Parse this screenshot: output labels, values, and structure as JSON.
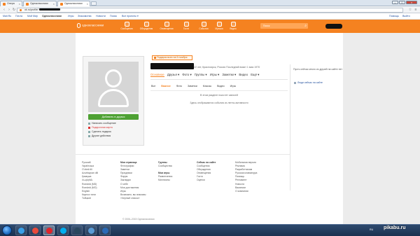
{
  "browser": {
    "tabs": [
      {
        "label": "Опера"
      },
      {
        "label": "Одноклассники"
      },
      {
        "label": "Одноклассники"
      }
    ],
    "url_prefix": "ok.ru/profile/",
    "bookmarks": [
      {
        "label": "Mail.Ru"
      },
      {
        "label": "Почта"
      },
      {
        "label": "Мой Мир"
      },
      {
        "label": "Одноклассники"
      },
      {
        "label": "Игры"
      },
      {
        "label": "Знакомства"
      },
      {
        "label": "Новости"
      },
      {
        "label": "Поиск"
      },
      {
        "label": "Все проекты ▾"
      }
    ],
    "bookmarks_right": [
      "Помощь",
      "Выйти",
      "Настр."
    ]
  },
  "ok": {
    "logo": "одноклассники",
    "nav": [
      {
        "label": "Сообщения",
        "icon": "messages-icon"
      },
      {
        "label": "Обсуждения",
        "icon": "discussions-icon"
      },
      {
        "label": "Оповещения",
        "icon": "notifications-icon"
      },
      {
        "label": "Гости",
        "icon": "guests-icon"
      },
      {
        "label": "События",
        "icon": "events-icon"
      },
      {
        "label": "Музыка",
        "icon": "music-icon"
      },
      {
        "label": "Видео",
        "icon": "video-icon"
      }
    ],
    "search_placeholder": "Поиск",
    "accent": "#f58220"
  },
  "profile": {
    "gift_banner": "Подарок всех на 5 ноября",
    "info": "22 лет, Красноярск, Россия  Последний визит 1 мая 1970",
    "tabs": [
      "Основное",
      "Друзья ▾",
      "Фото ▾",
      "Группы ▾",
      "Игры ▾",
      "Заметки ▾",
      "Видео",
      "Ещё ▾"
    ],
    "add_friend": "Добавить в друзья",
    "actions": [
      {
        "label": "Написать сообщение",
        "icon": "message-icon",
        "red": false
      },
      {
        "label": "Подарочная карта",
        "icon": "gift-card-icon",
        "red": true
      },
      {
        "label": "Сделать подарок",
        "icon": "gift-icon",
        "red": false
      },
      {
        "label": "Другие действия",
        "icon": "more-icon",
        "red": false
      }
    ],
    "feed_tabs": [
      "Все",
      "Важное",
      "Фото",
      "Заметки",
      "Классы",
      "Видео",
      "Игры"
    ],
    "feed_empty": "В этом разделе пока нет записей",
    "feed_hint": "Здесь отображаются события из ленты активности",
    "right_text": "Пусть сейчас много из друзей на сайте нет",
    "right_link": "Люди сейчас на сайте"
  },
  "footer": {
    "columns": [
      {
        "heading": "",
        "items": [
          "Русский",
          "Українська",
          "Oʻzbek tili",
          "Azərbaycan dili",
          "Қазақша",
          "Հայերեն",
          "Română (MD)",
          "Română (MO)",
          "English",
          "Кыргыз тили",
          "Тойҷикӣ"
        ]
      },
      {
        "heading": "Моя страница",
        "items": [
          "Фотографии",
          "Заметки",
          "Праздники",
          "Форум",
          "Закладки",
          "О себе",
          "Мои достижения",
          "Игры",
          "Возможно, вы знакомы",
          "«Черный список»"
        ]
      },
      {
        "heading": "Группы",
        "items": [
          "Сообщества",
          "",
          "Мои игры",
          "Развлечения",
          "Миллионы"
        ]
      },
      {
        "heading": "Сейчас на сайте",
        "items": [
          "Сообщения",
          "Обсуждения",
          "Оповещения",
          "Гости",
          "Оценки"
        ]
      },
      {
        "heading": "",
        "items": [
          "Мобильная версия",
          "Реклама",
          "Разработчикам",
          "Русская клавиатура",
          "Помощь",
          "Регламент",
          "Новости",
          "Вакансии",
          "О компании"
        ]
      }
    ],
    "copyright": "© 2006–2015 Одноклассники"
  },
  "taskbar": {
    "apps": [
      {
        "name": "ie-icon",
        "color": "#3aa0e8"
      },
      {
        "name": "chrome-icon",
        "color": "#e94b3c"
      },
      {
        "name": "opera-icon",
        "color": "#e0242b"
      },
      {
        "name": "skype-icon",
        "color": "#00aff0"
      },
      {
        "name": "steam-icon",
        "color": "#2a475e"
      },
      {
        "name": "player-icon",
        "color": "#5a9bd5"
      },
      {
        "name": "photoshop-icon",
        "color": "#2a6ab6"
      }
    ],
    "tray": "RU"
  },
  "watermark": "pikabu.ru"
}
